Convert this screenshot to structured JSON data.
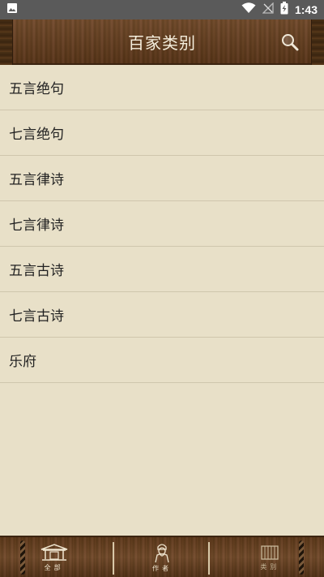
{
  "status_bar": {
    "time": "1:43",
    "icons": [
      "image-icon",
      "wifi-icon",
      "signal-off-icon",
      "battery-charging-icon"
    ]
  },
  "header": {
    "title": "百家类别",
    "search_icon": "search-icon"
  },
  "categories": [
    {
      "label": "五言绝句"
    },
    {
      "label": "七言绝句"
    },
    {
      "label": "五言律诗"
    },
    {
      "label": "七言律诗"
    },
    {
      "label": "五言古诗"
    },
    {
      "label": "七言古诗"
    },
    {
      "label": "乐府"
    }
  ],
  "bottom_nav": [
    {
      "label": "全部",
      "icon": "temple-icon"
    },
    {
      "label": "作者",
      "icon": "poet-icon"
    },
    {
      "label": "类别",
      "icon": "scroll-icon"
    }
  ],
  "colors": {
    "background": "#e8e0c8",
    "wood": "#6b4220",
    "status_bar": "#5a5a5a"
  }
}
